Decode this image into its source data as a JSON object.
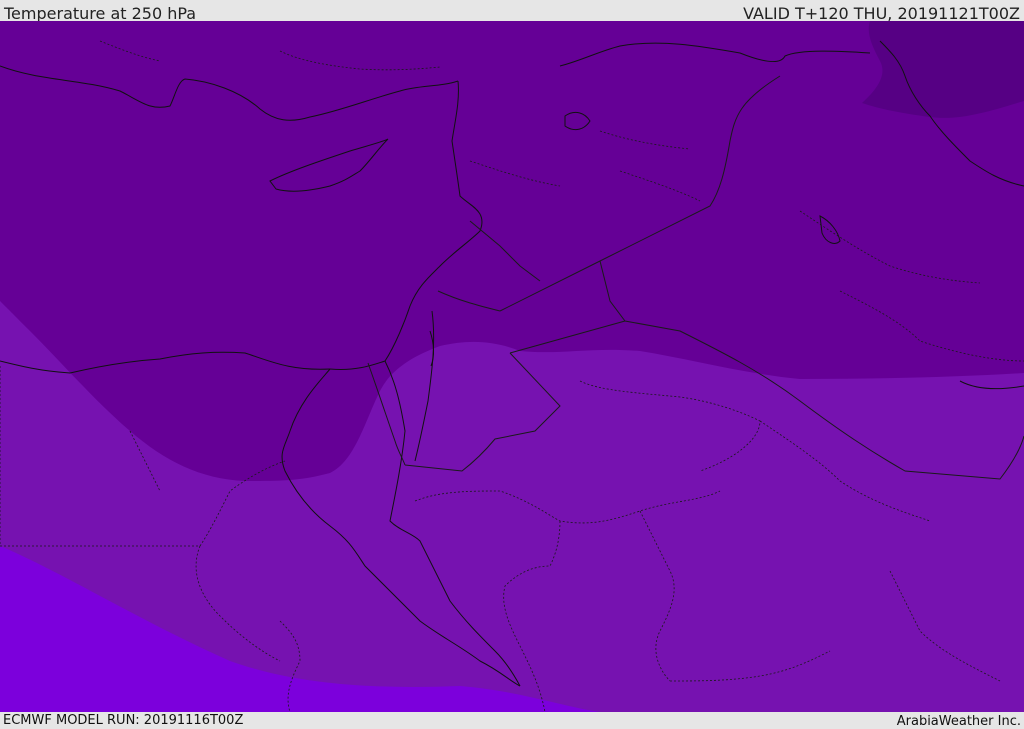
{
  "header": {
    "title": "Temperature at 250 hPa",
    "valid_time": "VALID T+120 THU, 20191121T00Z"
  },
  "footer": {
    "model_run": "ECMWF MODEL RUN: 20191116T00Z",
    "credit": "ArabiaWeather Inc."
  },
  "map": {
    "colors": {
      "zone_coldest": "#560084",
      "zone_cold": "#650096",
      "zone_mid": "#7612b0",
      "zone_warm": "#7c00dc",
      "coastline": "#111111",
      "border": "#1a1a1a"
    }
  }
}
